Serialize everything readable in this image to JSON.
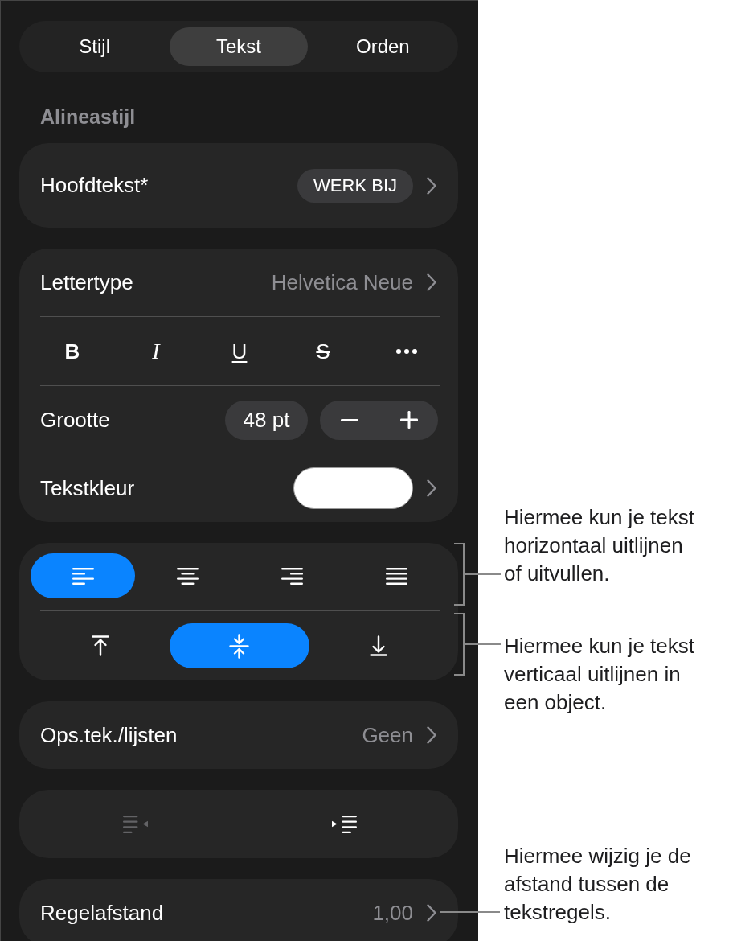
{
  "tabs": [
    {
      "label": "Stijl",
      "selected": false
    },
    {
      "label": "Tekst",
      "selected": true
    },
    {
      "label": "Orden",
      "selected": false
    }
  ],
  "paragraph_style": {
    "heading": "Alineastijl",
    "name": "Hoofdtekst*",
    "update_button": "WERK BIJ"
  },
  "font": {
    "label": "Lettertype",
    "value": "Helvetica Neue"
  },
  "style_buttons": [
    {
      "kind": "bold",
      "label": "B"
    },
    {
      "kind": "italic",
      "label": "I"
    },
    {
      "kind": "underline",
      "label": "U"
    },
    {
      "kind": "strikethrough",
      "label": "S"
    },
    {
      "kind": "more"
    }
  ],
  "size": {
    "label": "Grootte",
    "value": "48 pt"
  },
  "text_color": {
    "label": "Tekstkleur",
    "color": "#ffffff"
  },
  "horizontal_alignment": [
    {
      "kind": "left",
      "selected": true
    },
    {
      "kind": "center",
      "selected": false
    },
    {
      "kind": "right",
      "selected": false
    },
    {
      "kind": "justify",
      "selected": false
    }
  ],
  "vertical_alignment": [
    {
      "kind": "top",
      "selected": false
    },
    {
      "kind": "middle",
      "selected": true
    },
    {
      "kind": "bottom",
      "selected": false
    }
  ],
  "bullets": {
    "label": "Ops.tek./lijsten",
    "value": "Geen"
  },
  "indent": [
    {
      "kind": "decrease",
      "disabled": true
    },
    {
      "kind": "increase",
      "disabled": false
    }
  ],
  "line_spacing": {
    "label": "Regelafstand",
    "value": "1,00"
  },
  "callouts": [
    {
      "kind": "bracket",
      "text": "Hiermee kun je tekst horizontaal uitlijnen of uitvullen."
    },
    {
      "kind": "bracket",
      "text": "Hiermee kun je tekst verticaal uitlijnen in een object."
    },
    {
      "kind": "line",
      "text": "Hiermee wijzig je de afstand tussen de tekstregels."
    }
  ]
}
